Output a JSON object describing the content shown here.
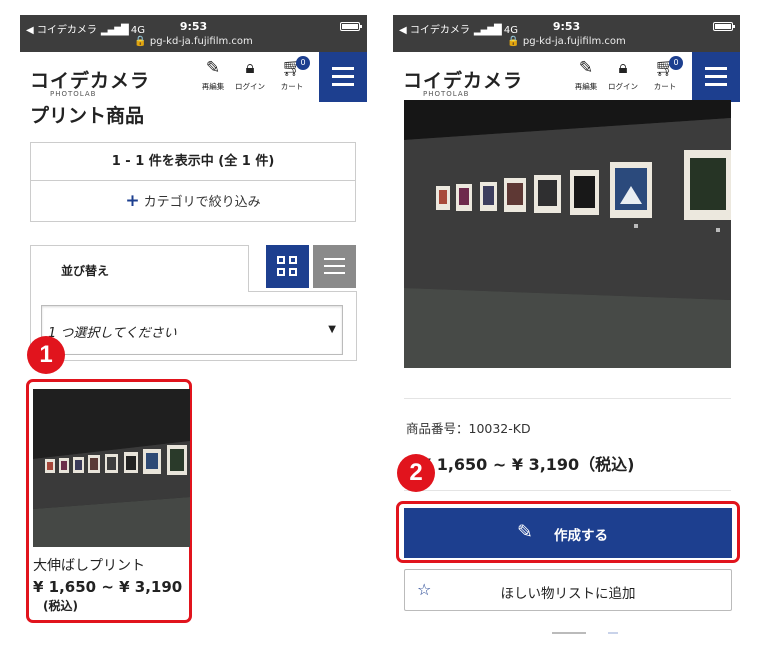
{
  "status_bar": {
    "carrier": "◀ コイデカメラ",
    "signal": "▂▄▆█",
    "network": "4G",
    "time": "9:53",
    "url": "🔒 pg-kd-ja.fujifilm.com"
  },
  "header": {
    "logo": "コイデカメラ",
    "logo_sub": "PHOTOLAB",
    "icons": [
      {
        "name": "reedit",
        "icon": "edit-icon",
        "label": "再編集"
      },
      {
        "name": "login",
        "icon": "lock-icon",
        "label": "ログイン"
      },
      {
        "name": "cart",
        "icon": "cart-icon",
        "label": "カート",
        "badge": "0"
      }
    ],
    "menu_icon": "hamburger-icon"
  },
  "left_screen": {
    "page_title": "プリント商品",
    "result_count": "1 - 1 件を表示中 (全 1 件)",
    "filter_plus": "+",
    "filter_label": "カテゴリで絞り込み",
    "sort_tab_label": "並び替え",
    "sort_select_value": "1 つ選択してください",
    "sort_select_arrow": "▼",
    "step_number": "1",
    "product": {
      "name": "大伸ばしプリント",
      "price": "¥ 1,650 ~ ¥ 3,190",
      "tax": "(税込)"
    }
  },
  "right_screen": {
    "sku": "商品番号：10032-KD",
    "price": "¥ 1,650 ~ ¥ 3,190（税込)",
    "step_number": "2",
    "create_label": "作成する",
    "wishlist_label": "ほしい物リストに追加"
  },
  "colors": {
    "accent_blue": "#1d3f8f",
    "highlight_red": "#e1141d",
    "status_bar": "#3d3d3d"
  }
}
